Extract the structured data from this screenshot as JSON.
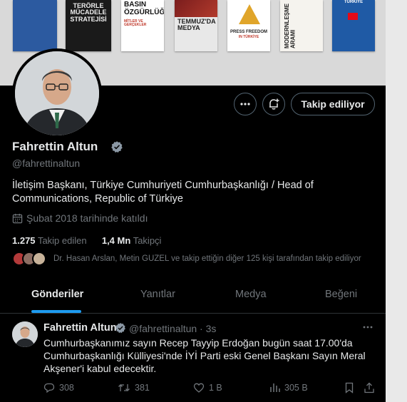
{
  "banner": {
    "books": [
      {
        "title": "",
        "color": "#2c5aa0"
      },
      {
        "title": "TERÖRLE MÜCADELE STRATEJİSİ",
        "color": "#1a1a1a"
      },
      {
        "title": "BASIN ÖZGÜRLÜĞÜ",
        "subtitle": "MİTLER VE GERÇEKLER",
        "color": "#ffffff"
      },
      {
        "title": "TEMMUZ'DA MEDYA",
        "color": "#e8e8e8"
      },
      {
        "title": "PRESS FREEDOM",
        "subtitle": "IN TÜRKİYE",
        "color": "#ffffff"
      },
      {
        "title": "MODERNLEŞME ARAMI",
        "color": "#f5f3ee"
      },
      {
        "title": "TÜRKİYE",
        "color": "#1f5aa5"
      }
    ]
  },
  "profile": {
    "name": "Fahrettin Altun",
    "handle": "@fahrettinaltun",
    "bio": "İletişim Başkanı, Türkiye Cumhuriyeti Cumhurbaşkanlığı / Head of Communications, Republic of Türkiye",
    "joined": "Şubat 2018 tarihinde katıldı",
    "following_count": "1.275",
    "following_label": "Takip edilen",
    "followers_count": "1,4 Mn",
    "followers_label": "Takipçi",
    "followed_by": "Dr. Hasan Arslan, Metin GUZEL ve takip ettiğin diğer 125 kişi tarafından takip ediliyor",
    "follow_button": "Takip ediliyor"
  },
  "icons": {
    "more": "more-icon",
    "notify": "bell-plus-icon",
    "verified": "verified-badge-icon",
    "calendar": "calendar-icon"
  },
  "colors": {
    "accent": "#1d9bf0",
    "background": "#000000",
    "muted": "#71767b",
    "text": "#e7e9ea",
    "border": "#2f3336"
  },
  "tabs": [
    {
      "label": "Gönderiler",
      "active": true
    },
    {
      "label": "Yanıtlar",
      "active": false
    },
    {
      "label": "Medya",
      "active": false
    },
    {
      "label": "Beğeni",
      "active": false
    }
  ],
  "tweet": {
    "name": "Fahrettin Altun",
    "handle": "@fahrettinaltun",
    "time": "3s",
    "text": "Cumhurbaşkanımız sayın Recep Tayyip Erdoğan bugün saat 17.00'da Cumhurbaşkanlığı Külliyesi'nde İYİ Parti eski Genel Başkanı Sayın Meral Akşener'i kabul edecektir.",
    "replies": "308",
    "reposts": "381",
    "likes": "1 B",
    "views": "305 B"
  }
}
